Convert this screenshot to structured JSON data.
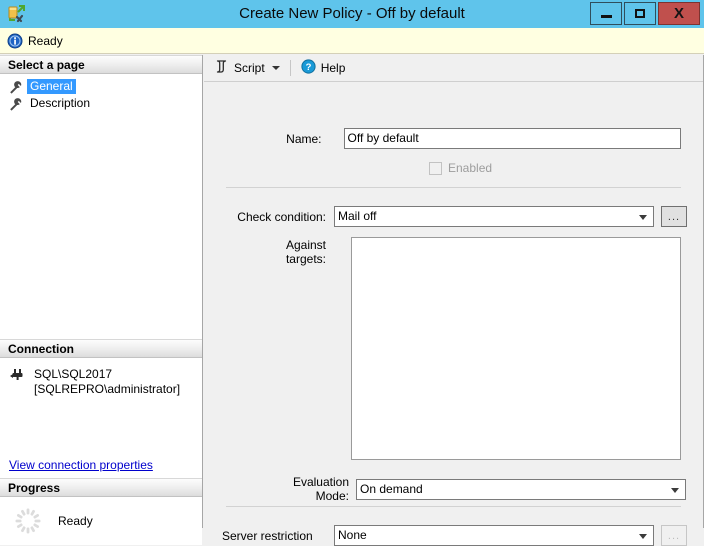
{
  "window": {
    "title": "Create New Policy - Off by default",
    "title_icon": "policy-create-icon",
    "controls": {
      "minimize": "minimize-icon",
      "maximize": "maximize-icon",
      "close": "X"
    }
  },
  "status": {
    "icon": "info-icon",
    "text": "Ready"
  },
  "sidebar": {
    "select_page_header": "Select a page",
    "pages": [
      {
        "label": "General",
        "icon": "wrench-icon",
        "selected": true
      },
      {
        "label": "Description",
        "icon": "wrench-icon",
        "selected": false
      }
    ],
    "connection": {
      "header": "Connection",
      "icon": "connection-plug-icon",
      "server": "SQL\\SQL2017",
      "user": "[SQLREPRO\\administrator]",
      "link": "View connection properties"
    },
    "progress": {
      "header": "Progress",
      "icon": "spinner-icon",
      "text": "Ready"
    }
  },
  "toolbar": {
    "script_label": "Script",
    "script_icon": "script-icon",
    "script_caret": "chevron-down-icon",
    "help_label": "Help",
    "help_icon": "help-question-icon"
  },
  "form": {
    "name_label": "Name:",
    "name_value": "Off by default",
    "enabled_label": "Enabled",
    "enabled_checked": false,
    "check_condition_label": "Check condition:",
    "check_condition_value": "Mail off",
    "check_condition_browse": "...",
    "against_targets_label": "Against targets:",
    "against_targets_value": "",
    "evaluation_mode_label": "Evaluation Mode:",
    "evaluation_mode_value": "On demand",
    "server_restriction_label": "Server restriction",
    "server_restriction_value": "None",
    "server_restriction_browse": "..."
  },
  "colors": {
    "titlebar": "#5fc4eb",
    "close_button": "#c0504d",
    "status_bar": "#ffffe1",
    "selection": "#3399ff",
    "link": "#0000cc",
    "dialog_bg": "#f0f0f0"
  }
}
